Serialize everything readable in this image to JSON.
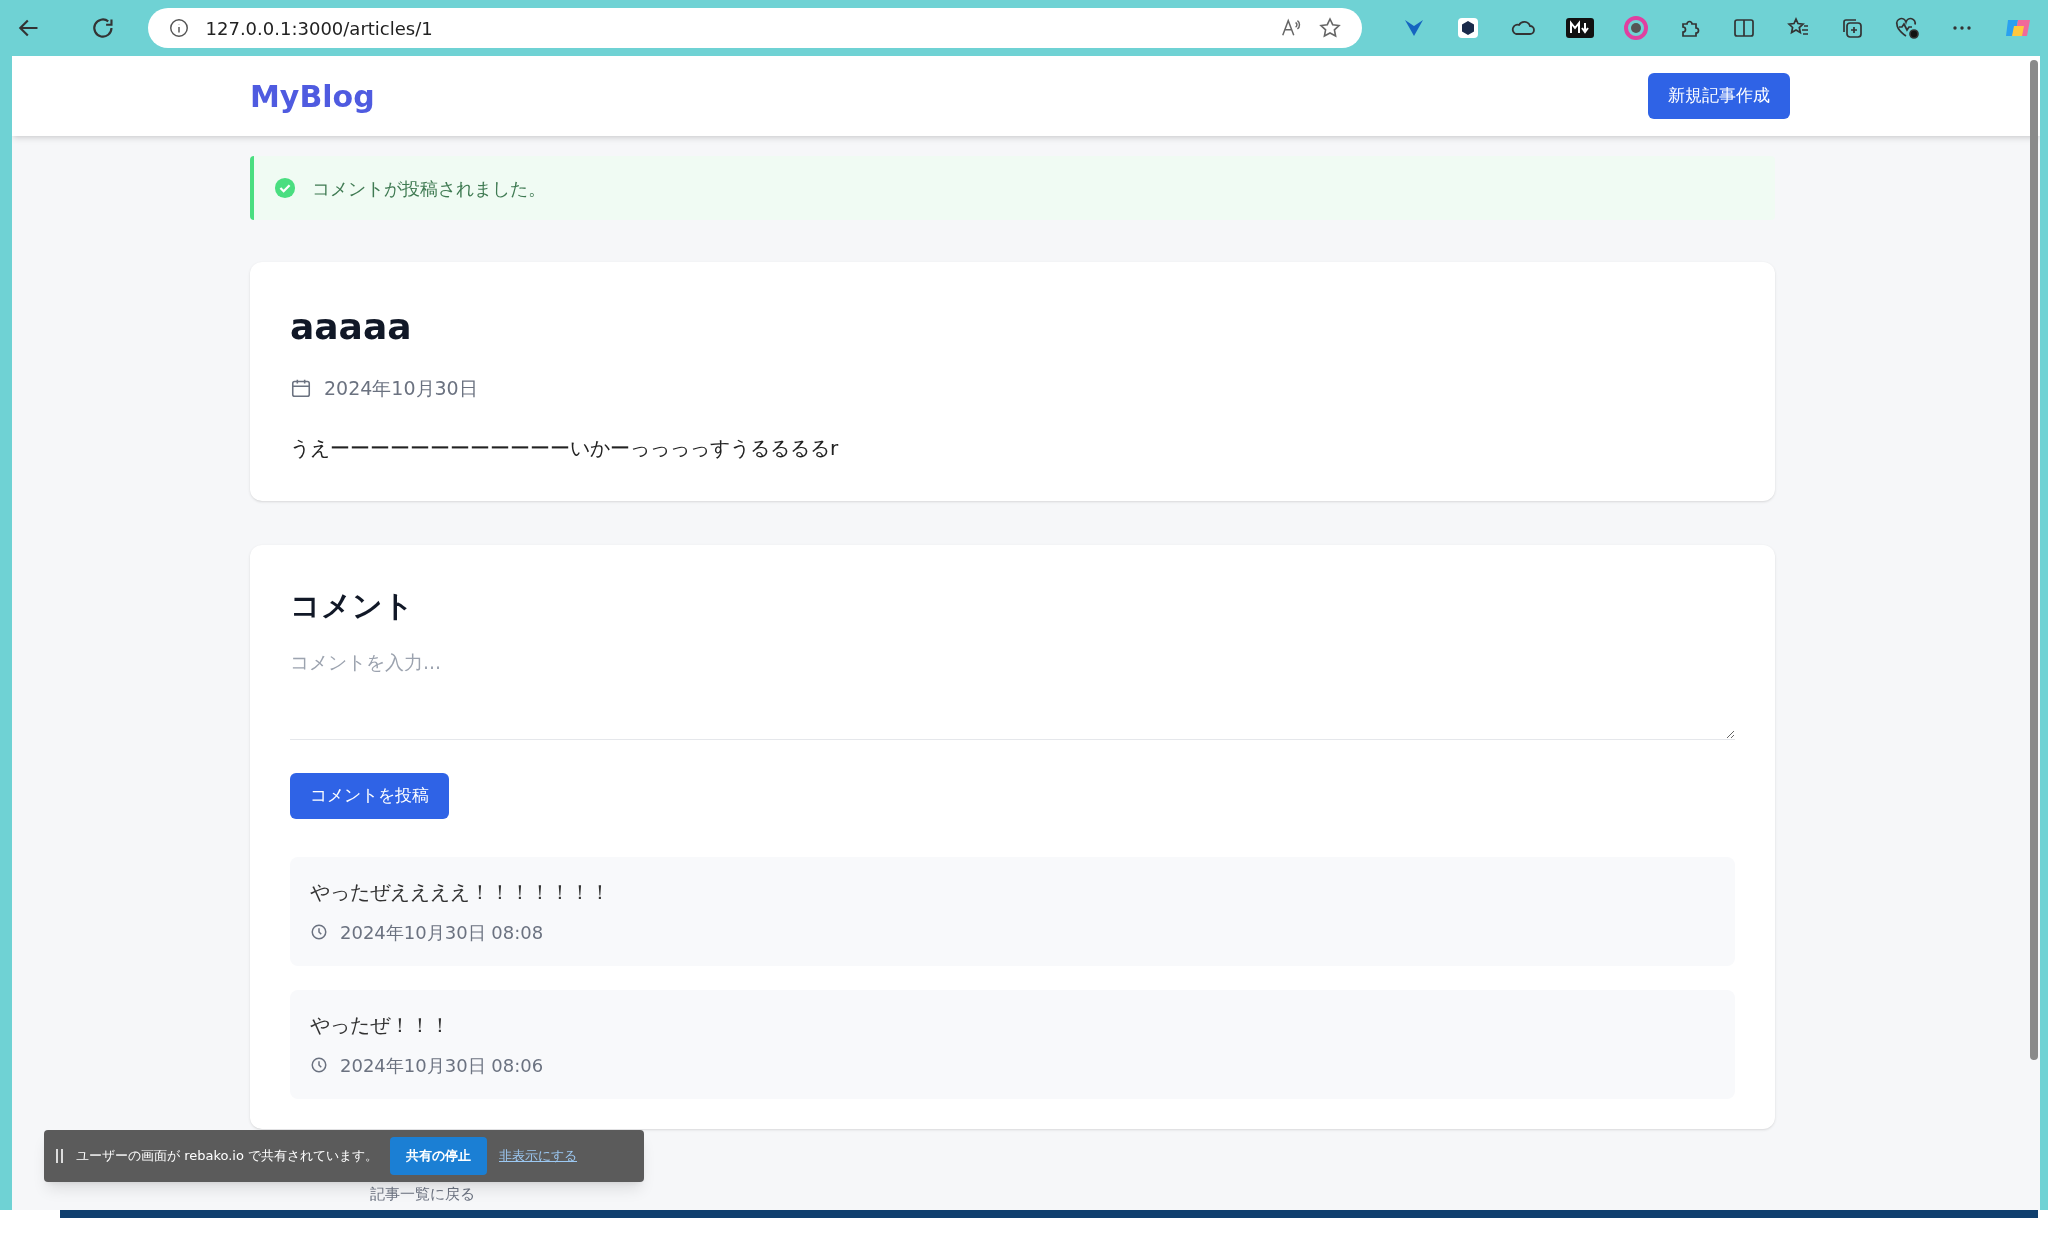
{
  "browser": {
    "url": "127.0.0.1:3000/articles/1"
  },
  "header": {
    "logo": "MyBlog",
    "new_article_button": "新規記事作成"
  },
  "flash": {
    "message": "コメントが投稿されました。"
  },
  "article": {
    "title": "aaaaa",
    "date": "2024年10月30日",
    "body": "うえーーーーーーーーーーーーいかーっっっっすうるるるるr"
  },
  "comments": {
    "heading": "コメント",
    "input": {
      "placeholder": "コメントを入力..."
    },
    "submit_button": "コメントを投稿",
    "items": [
      {
        "text": "やったぜええええ！！！！！！！",
        "time": "2024年10月30日 08:08"
      },
      {
        "text": "やったぜ！！！",
        "time": "2024年10月30日 08:06"
      }
    ]
  },
  "back_link": "記事一覧に戻る",
  "share_bar": {
    "message": "ユーザーの画面が rebako.io で共有されています。",
    "stop_button": "共有の停止",
    "hide_link": "非表示にする"
  }
}
